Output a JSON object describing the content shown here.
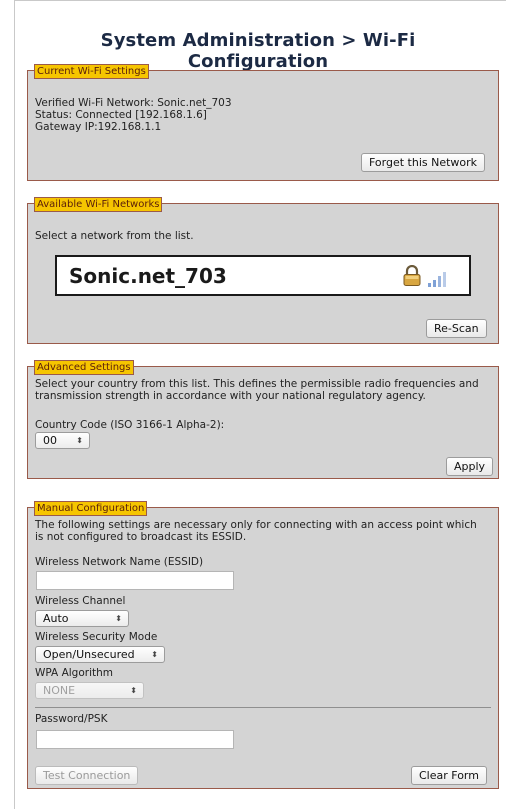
{
  "page": {
    "title": "System Administration > Wi-Fi Configuration"
  },
  "current": {
    "legend": "Current Wi-Fi Settings",
    "line1": "Verified Wi-Fi Network: Sonic.net_703",
    "line2": "Status: Connected [192.168.1.6]",
    "line3": "Gateway IP:192.168.1.1",
    "forget_label": "Forget this Network"
  },
  "available": {
    "legend": "Available Wi-Fi Networks",
    "instruction": "Select a network from the list.",
    "network_name": "Sonic.net_703",
    "rescan_label": "Re-Scan"
  },
  "advanced": {
    "legend": "Advanced Settings",
    "desc1": "Select your country from this list. This defines the permissible radio frequencies and",
    "desc2": "transmission strength in accordance with your national regulatory agency.",
    "country_label": "Country Code (ISO 3166-1 Alpha-2):",
    "country_value": "00",
    "apply_label": "Apply"
  },
  "manual": {
    "legend": "Manual Configuration",
    "desc1": "The following settings are necessary only for connecting with an access point which",
    "desc2": "is not configured to broadcast its ESSID.",
    "essid_label": "Wireless Network Name (ESSID)",
    "essid_value": "",
    "channel_label": "Wireless Channel",
    "channel_value": "Auto",
    "security_label": "Wireless Security Mode",
    "security_value": "Open/Unsecured",
    "wpa_label": "WPA Algorithm",
    "wpa_value": "NONE",
    "psk_label": "Password/PSK",
    "psk_value": "",
    "test_label": "Test Connection",
    "clear_label": "Clear Form"
  },
  "colors": {
    "legend_bg": "#f6c500",
    "section_bg": "#d4d4d4",
    "section_border": "#9a5a4a",
    "title": "#1c2a44"
  },
  "icons": {
    "lock": "lock-icon",
    "signal": "signal-strength-icon",
    "select_arrows": "updown-arrows-icon"
  }
}
